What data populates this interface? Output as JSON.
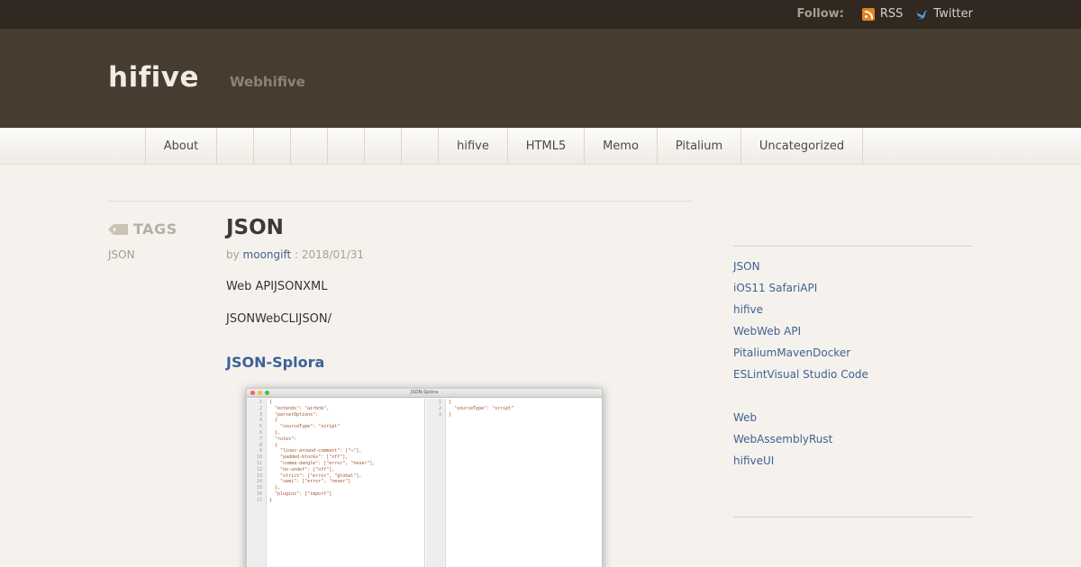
{
  "topbar": {
    "follow_label": "Follow:",
    "links": [
      {
        "label": "RSS",
        "icon": "rss-icon"
      },
      {
        "label": "Twitter",
        "icon": "twitter-icon"
      }
    ]
  },
  "header": {
    "site_title": "hifive",
    "site_description": "Webhifive"
  },
  "nav": {
    "items": [
      "About",
      "",
      "",
      "",
      "",
      "",
      "",
      "hifive",
      "HTML5",
      "Memo",
      "Pitalium",
      "Uncategorized"
    ]
  },
  "tags": {
    "heading": "TAGS",
    "items": [
      "JSON"
    ]
  },
  "post": {
    "title": "JSON",
    "by": "by",
    "author": "moongift",
    "date_sep": " : ",
    "date": "2018/01/31",
    "paragraphs": [
      "Web APIJSONXML",
      "JSONWebCLIJSON/"
    ],
    "subheading": "JSON-Splora",
    "screenshot": {
      "window_title": "JSON-Splora",
      "left_code": [
        "{",
        "  \"extends\": \"airbnb\",",
        "  \"parserOptions\":",
        "  {",
        "    \"sourceType\": \"script\"",
        "  },",
        "  \"rules\":",
        "  {",
        "    \"lines-around-comment\": [\"↔\"],",
        "    \"padded-blocks\": [\"off\"],",
        "    \"comma-dangle\": [\"error\", \"never\"],",
        "    \"no-undef\": [\"off\"],",
        "    \"strict\": [\"error\", \"global\"],",
        "    \"semi\": [\"error\", \"never\"]",
        "  },",
        "  \"plugins\": [\"import\"]",
        "}"
      ],
      "right_code": [
        "{",
        "  \"sourceType\": \"script\"",
        "}"
      ]
    }
  },
  "sidebar": {
    "links": [
      "JSON",
      "iOS11 SafariAPI",
      "hifive",
      "WebWeb API",
      "PitaliumMavenDocker",
      "ESLintVisual Studio Code",
      "Web",
      "WebAssemblyRust",
      "hifiveUI"
    ]
  },
  "colors": {
    "topbar_bg": "#302821",
    "header_bg": "#463c30",
    "link": "#41618f",
    "rss": "#e8821f",
    "twitter": "#4aa3df"
  }
}
